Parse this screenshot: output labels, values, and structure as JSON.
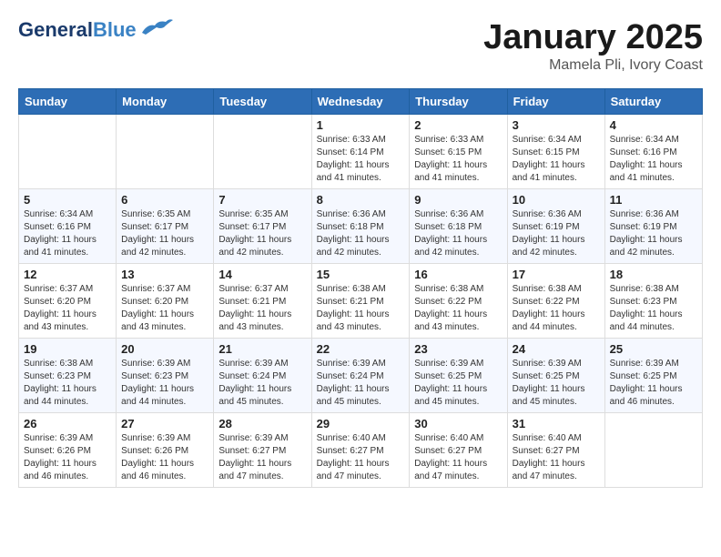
{
  "header": {
    "logo_general": "General",
    "logo_blue": "Blue",
    "month": "January 2025",
    "location": "Mamela Pli, Ivory Coast"
  },
  "days_of_week": [
    "Sunday",
    "Monday",
    "Tuesday",
    "Wednesday",
    "Thursday",
    "Friday",
    "Saturday"
  ],
  "weeks": [
    [
      {
        "day": "",
        "info": ""
      },
      {
        "day": "",
        "info": ""
      },
      {
        "day": "",
        "info": ""
      },
      {
        "day": "1",
        "info": "Sunrise: 6:33 AM\nSunset: 6:14 PM\nDaylight: 11 hours\nand 41 minutes."
      },
      {
        "day": "2",
        "info": "Sunrise: 6:33 AM\nSunset: 6:15 PM\nDaylight: 11 hours\nand 41 minutes."
      },
      {
        "day": "3",
        "info": "Sunrise: 6:34 AM\nSunset: 6:15 PM\nDaylight: 11 hours\nand 41 minutes."
      },
      {
        "day": "4",
        "info": "Sunrise: 6:34 AM\nSunset: 6:16 PM\nDaylight: 11 hours\nand 41 minutes."
      }
    ],
    [
      {
        "day": "5",
        "info": "Sunrise: 6:34 AM\nSunset: 6:16 PM\nDaylight: 11 hours\nand 41 minutes."
      },
      {
        "day": "6",
        "info": "Sunrise: 6:35 AM\nSunset: 6:17 PM\nDaylight: 11 hours\nand 42 minutes."
      },
      {
        "day": "7",
        "info": "Sunrise: 6:35 AM\nSunset: 6:17 PM\nDaylight: 11 hours\nand 42 minutes."
      },
      {
        "day": "8",
        "info": "Sunrise: 6:36 AM\nSunset: 6:18 PM\nDaylight: 11 hours\nand 42 minutes."
      },
      {
        "day": "9",
        "info": "Sunrise: 6:36 AM\nSunset: 6:18 PM\nDaylight: 11 hours\nand 42 minutes."
      },
      {
        "day": "10",
        "info": "Sunrise: 6:36 AM\nSunset: 6:19 PM\nDaylight: 11 hours\nand 42 minutes."
      },
      {
        "day": "11",
        "info": "Sunrise: 6:36 AM\nSunset: 6:19 PM\nDaylight: 11 hours\nand 42 minutes."
      }
    ],
    [
      {
        "day": "12",
        "info": "Sunrise: 6:37 AM\nSunset: 6:20 PM\nDaylight: 11 hours\nand 43 minutes."
      },
      {
        "day": "13",
        "info": "Sunrise: 6:37 AM\nSunset: 6:20 PM\nDaylight: 11 hours\nand 43 minutes."
      },
      {
        "day": "14",
        "info": "Sunrise: 6:37 AM\nSunset: 6:21 PM\nDaylight: 11 hours\nand 43 minutes."
      },
      {
        "day": "15",
        "info": "Sunrise: 6:38 AM\nSunset: 6:21 PM\nDaylight: 11 hours\nand 43 minutes."
      },
      {
        "day": "16",
        "info": "Sunrise: 6:38 AM\nSunset: 6:22 PM\nDaylight: 11 hours\nand 43 minutes."
      },
      {
        "day": "17",
        "info": "Sunrise: 6:38 AM\nSunset: 6:22 PM\nDaylight: 11 hours\nand 44 minutes."
      },
      {
        "day": "18",
        "info": "Sunrise: 6:38 AM\nSunset: 6:23 PM\nDaylight: 11 hours\nand 44 minutes."
      }
    ],
    [
      {
        "day": "19",
        "info": "Sunrise: 6:38 AM\nSunset: 6:23 PM\nDaylight: 11 hours\nand 44 minutes."
      },
      {
        "day": "20",
        "info": "Sunrise: 6:39 AM\nSunset: 6:23 PM\nDaylight: 11 hours\nand 44 minutes."
      },
      {
        "day": "21",
        "info": "Sunrise: 6:39 AM\nSunset: 6:24 PM\nDaylight: 11 hours\nand 45 minutes."
      },
      {
        "day": "22",
        "info": "Sunrise: 6:39 AM\nSunset: 6:24 PM\nDaylight: 11 hours\nand 45 minutes."
      },
      {
        "day": "23",
        "info": "Sunrise: 6:39 AM\nSunset: 6:25 PM\nDaylight: 11 hours\nand 45 minutes."
      },
      {
        "day": "24",
        "info": "Sunrise: 6:39 AM\nSunset: 6:25 PM\nDaylight: 11 hours\nand 45 minutes."
      },
      {
        "day": "25",
        "info": "Sunrise: 6:39 AM\nSunset: 6:25 PM\nDaylight: 11 hours\nand 46 minutes."
      }
    ],
    [
      {
        "day": "26",
        "info": "Sunrise: 6:39 AM\nSunset: 6:26 PM\nDaylight: 11 hours\nand 46 minutes."
      },
      {
        "day": "27",
        "info": "Sunrise: 6:39 AM\nSunset: 6:26 PM\nDaylight: 11 hours\nand 46 minutes."
      },
      {
        "day": "28",
        "info": "Sunrise: 6:39 AM\nSunset: 6:27 PM\nDaylight: 11 hours\nand 47 minutes."
      },
      {
        "day": "29",
        "info": "Sunrise: 6:40 AM\nSunset: 6:27 PM\nDaylight: 11 hours\nand 47 minutes."
      },
      {
        "day": "30",
        "info": "Sunrise: 6:40 AM\nSunset: 6:27 PM\nDaylight: 11 hours\nand 47 minutes."
      },
      {
        "day": "31",
        "info": "Sunrise: 6:40 AM\nSunset: 6:27 PM\nDaylight: 11 hours\nand 47 minutes."
      },
      {
        "day": "",
        "info": ""
      }
    ]
  ]
}
